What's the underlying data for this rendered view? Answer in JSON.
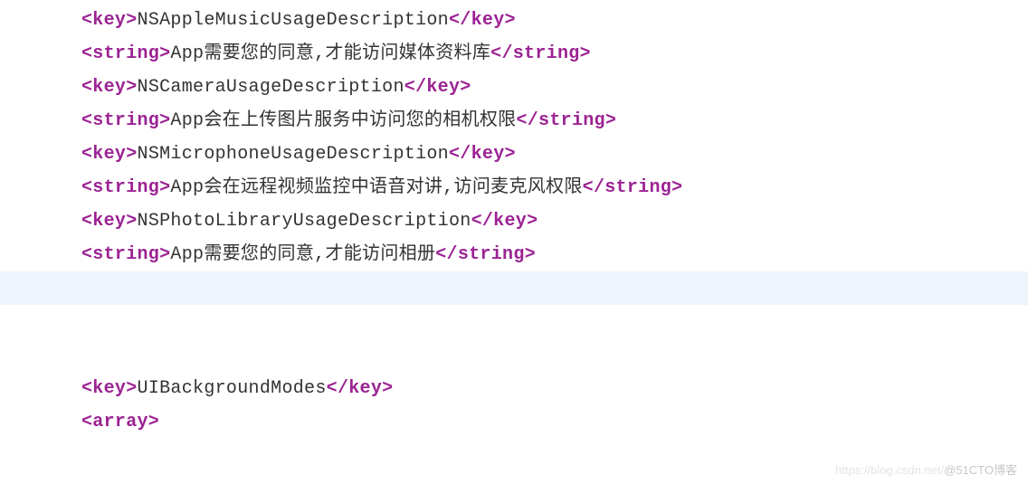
{
  "lines": [
    {
      "tag": "key",
      "content": "NSAppleMusicUsageDescription"
    },
    {
      "tag": "string",
      "content": "App需要您的同意,才能访问媒体资料库"
    },
    {
      "tag": "key",
      "content": "NSCameraUsageDescription"
    },
    {
      "tag": "string",
      "content": "App会在上传图片服务中访问您的相机权限"
    },
    {
      "tag": "key",
      "content": "NSMicrophoneUsageDescription"
    },
    {
      "tag": "string",
      "content": "App会在远程视频监控中语音对讲,访问麦克风权限"
    },
    {
      "tag": "key",
      "content": "NSPhotoLibraryUsageDescription"
    },
    {
      "tag": "string",
      "content": "App需要您的同意,才能访问相册"
    },
    {
      "blank": true,
      "highlighted": true
    },
    {
      "blank": true
    },
    {
      "blank": true
    },
    {
      "tag": "key",
      "content": "UIBackgroundModes"
    },
    {
      "tag_open": "array"
    }
  ],
  "watermark": {
    "faint": "https://blog.csdn.net/",
    "main": "@51CTO博客"
  }
}
